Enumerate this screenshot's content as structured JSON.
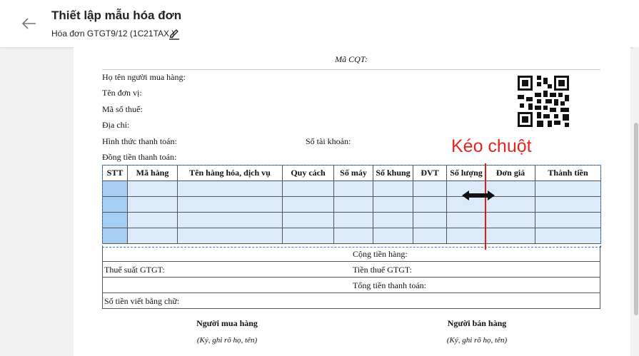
{
  "header": {
    "title": "Thiết lập mẫu hóa đơn",
    "subtitle": "Hóa đơn GTGT9/12 (1C21TAX )"
  },
  "invoice": {
    "ma_cqt": "Mã CQT:",
    "buyer_name": "Họ tên người mua hàng:",
    "unit_name": "Tên đơn vị:",
    "tax_code": "Mã số thuế:",
    "address": "Địa chỉ:",
    "payment_method": "Hình thức thanh toán:",
    "account_no": "Số tài khoản:",
    "currency": "Đồng tiền thanh toán:",
    "columns": [
      "STT",
      "Mã hàng",
      "Tên hàng hóa, dịch vụ",
      "Quy cách",
      "Số máy",
      "Số khung",
      "ĐVT",
      "Số lượng",
      "Đơn giá",
      "Thành tiền"
    ],
    "total_goods": "Cộng tiền hàng:",
    "vat_rate": "Thuế suất GTGT:",
    "vat_amount": "Tiền thuế GTGT:",
    "grand_total": "Tổng tiền thanh toán:",
    "amount_words": "Số tiền viết bằng chữ:",
    "buyer_sign_title": "Người mua hàng",
    "buyer_sign_note": "(Ký, ghi rõ họ, tên)",
    "seller_sign_title": "Người bán hàng",
    "seller_sign_note": "(Ký, ghi rõ họ, tên)"
  },
  "annotation": {
    "label": "Kéo chuột",
    "color": "#e5251d"
  },
  "icons": {
    "back": "arrow-left-icon",
    "edit": "pencil-icon",
    "qr": "qr-code-icon",
    "drag": "double-arrow-icon"
  }
}
